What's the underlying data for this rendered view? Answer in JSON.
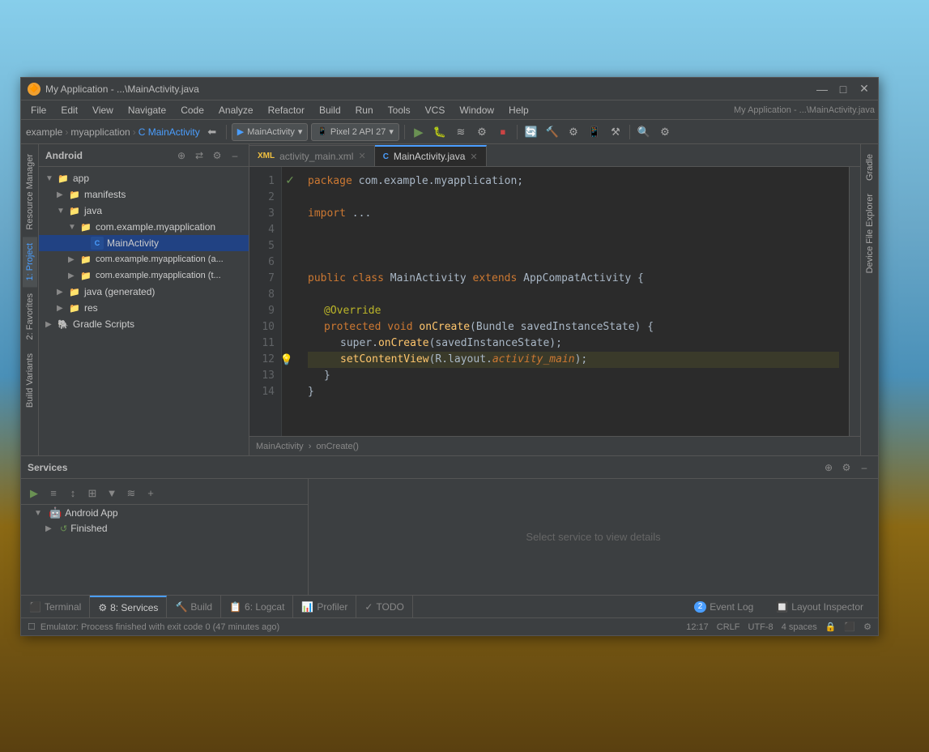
{
  "window": {
    "title": "My Application - ...\\MainActivity.java",
    "os_controls": {
      "minimize": "—",
      "maximize": "□",
      "close": "✕"
    }
  },
  "menu": {
    "items": [
      "File",
      "Edit",
      "View",
      "Navigate",
      "Code",
      "Analyze",
      "Refactor",
      "Build",
      "Run",
      "Tools",
      "VCS",
      "Window",
      "Help"
    ]
  },
  "toolbar": {
    "breadcrumb": {
      "example": "example",
      "myapplication": "myapplication",
      "mainactivity": "MainActivity"
    },
    "run_config": "MainActivity",
    "device": "Pixel 2 API 27"
  },
  "project_panel": {
    "title": "Android",
    "items": [
      {
        "label": "app",
        "type": "folder",
        "level": 0,
        "expanded": true
      },
      {
        "label": "manifests",
        "type": "folder",
        "level": 1,
        "expanded": false
      },
      {
        "label": "java",
        "type": "folder",
        "level": 1,
        "expanded": true
      },
      {
        "label": "com.example.myapplication",
        "type": "folder",
        "level": 2,
        "expanded": true
      },
      {
        "label": "MainActivity",
        "type": "java",
        "level": 3,
        "selected": true
      },
      {
        "label": "com.example.myapplication (androidTest)",
        "type": "folder",
        "level": 2,
        "expanded": false
      },
      {
        "label": "com.example.myapplication (test)",
        "type": "folder",
        "level": 2,
        "expanded": false
      },
      {
        "label": "java (generated)",
        "type": "folder",
        "level": 1,
        "expanded": false
      },
      {
        "label": "res",
        "type": "folder",
        "level": 1,
        "expanded": false
      },
      {
        "label": "Gradle Scripts",
        "type": "gradle",
        "level": 0,
        "expanded": false
      }
    ]
  },
  "editor": {
    "tabs": [
      {
        "label": "activity_main.xml",
        "type": "xml",
        "active": false
      },
      {
        "label": "MainActivity.java",
        "type": "java",
        "active": true
      }
    ],
    "breadcrumb": {
      "class": "MainActivity",
      "method": "onCreate()"
    },
    "lines": [
      {
        "num": 1,
        "content": "package com.example.myapplication;",
        "tokens": [
          {
            "t": "kw",
            "v": "package"
          },
          {
            "t": "pkg",
            "v": " com.example.myapplication;"
          }
        ]
      },
      {
        "num": 2,
        "content": "",
        "tokens": []
      },
      {
        "num": 3,
        "content": "import ...;",
        "tokens": [
          {
            "t": "kw",
            "v": "import"
          },
          {
            "t": "cmt",
            "v": " ..."
          }
        ]
      },
      {
        "num": 4,
        "content": "",
        "tokens": []
      },
      {
        "num": 5,
        "content": "",
        "tokens": []
      },
      {
        "num": 6,
        "content": "",
        "tokens": []
      },
      {
        "num": 7,
        "content": "public class MainActivity extends AppCompatActivity {",
        "tokens": [
          {
            "t": "kw",
            "v": "public"
          },
          {
            "t": "op",
            "v": " "
          },
          {
            "t": "kw",
            "v": "class"
          },
          {
            "t": "op",
            "v": " "
          },
          {
            "t": "cls",
            "v": "MainActivity"
          },
          {
            "t": "op",
            "v": " "
          },
          {
            "t": "kw",
            "v": "extends"
          },
          {
            "t": "op",
            "v": " "
          },
          {
            "t": "cls",
            "v": "AppCompatActivity"
          },
          {
            "t": "op",
            "v": " {"
          }
        ]
      },
      {
        "num": 8,
        "content": "",
        "tokens": []
      },
      {
        "num": 9,
        "content": "    @Override",
        "tokens": [
          {
            "t": "ann",
            "v": "    @Override"
          }
        ]
      },
      {
        "num": 10,
        "content": "    protected void onCreate(Bundle savedInstanceState) {",
        "tokens": [
          {
            "t": "op",
            "v": "    "
          },
          {
            "t": "kw",
            "v": "protected"
          },
          {
            "t": "op",
            "v": " "
          },
          {
            "t": "kw",
            "v": "void"
          },
          {
            "t": "op",
            "v": " "
          },
          {
            "t": "func",
            "v": "onCreate"
          },
          {
            "t": "op",
            "v": "("
          },
          {
            "t": "cls",
            "v": "Bundle"
          },
          {
            "t": "op",
            "v": " savedInstanceState) {"
          }
        ]
      },
      {
        "num": 11,
        "content": "        super.onCreate(savedInstanceState);",
        "tokens": [
          {
            "t": "op",
            "v": "        super."
          },
          {
            "t": "func",
            "v": "onCreate"
          },
          {
            "t": "op",
            "v": "(savedInstanceState);"
          }
        ]
      },
      {
        "num": 12,
        "content": "        setContentView(R.layout.activity_main);",
        "tokens": [
          {
            "t": "op",
            "v": "        "
          },
          {
            "t": "func",
            "v": "setContentView"
          },
          {
            "t": "op",
            "v": "(R.layout."
          },
          {
            "t": "kw2",
            "v": "activity_main"
          },
          {
            "t": "op",
            "v": ");"
          }
        ],
        "highlighted": true,
        "has_bulb": true
      },
      {
        "num": 13,
        "content": "    }",
        "tokens": [
          {
            "t": "op",
            "v": "    }"
          }
        ]
      },
      {
        "num": 14,
        "content": "}",
        "tokens": [
          {
            "t": "op",
            "v": "}"
          }
        ]
      }
    ]
  },
  "services": {
    "title": "Services",
    "toolbar_buttons": [
      "▶",
      "≡",
      "↕",
      "⊞",
      "▼",
      "≋",
      "+"
    ],
    "tree": [
      {
        "label": "Android App",
        "type": "android",
        "level": 0,
        "expanded": true
      },
      {
        "label": "Finished",
        "type": "finished",
        "level": 1
      }
    ],
    "detail_placeholder": "Select service to view details"
  },
  "bottom_tabs": [
    {
      "label": "Terminal",
      "icon": "terminal",
      "active": false,
      "number": null
    },
    {
      "label": "8: Services",
      "icon": "services",
      "active": true,
      "number": null
    },
    {
      "label": "Build",
      "icon": "build",
      "active": false,
      "number": null
    },
    {
      "label": "6: Logcat",
      "icon": "logcat",
      "active": false,
      "number": null
    },
    {
      "label": "Profiler",
      "icon": "profiler",
      "active": false,
      "number": null
    },
    {
      "label": "TODO",
      "icon": "todo",
      "active": false,
      "number": null
    }
  ],
  "bottom_right_tabs": [
    {
      "label": "Event Log",
      "icon": "event",
      "badge": "2"
    },
    {
      "label": "Layout Inspector",
      "icon": "layout"
    }
  ],
  "status_bar": {
    "message": "Emulator: Process finished with exit code 0 (47 minutes ago)",
    "position": "12:17",
    "line_ending": "CRLF",
    "encoding": "UTF-8",
    "indent": "4 spaces"
  },
  "side_tabs": {
    "left": [
      {
        "label": "Resource Manager"
      },
      {
        "label": "1: Project"
      },
      {
        "label": "2: Favorites"
      },
      {
        "label": "Build Variants"
      }
    ],
    "right": [
      {
        "label": "Gradle"
      },
      {
        "label": "Device File Explorer"
      }
    ]
  }
}
